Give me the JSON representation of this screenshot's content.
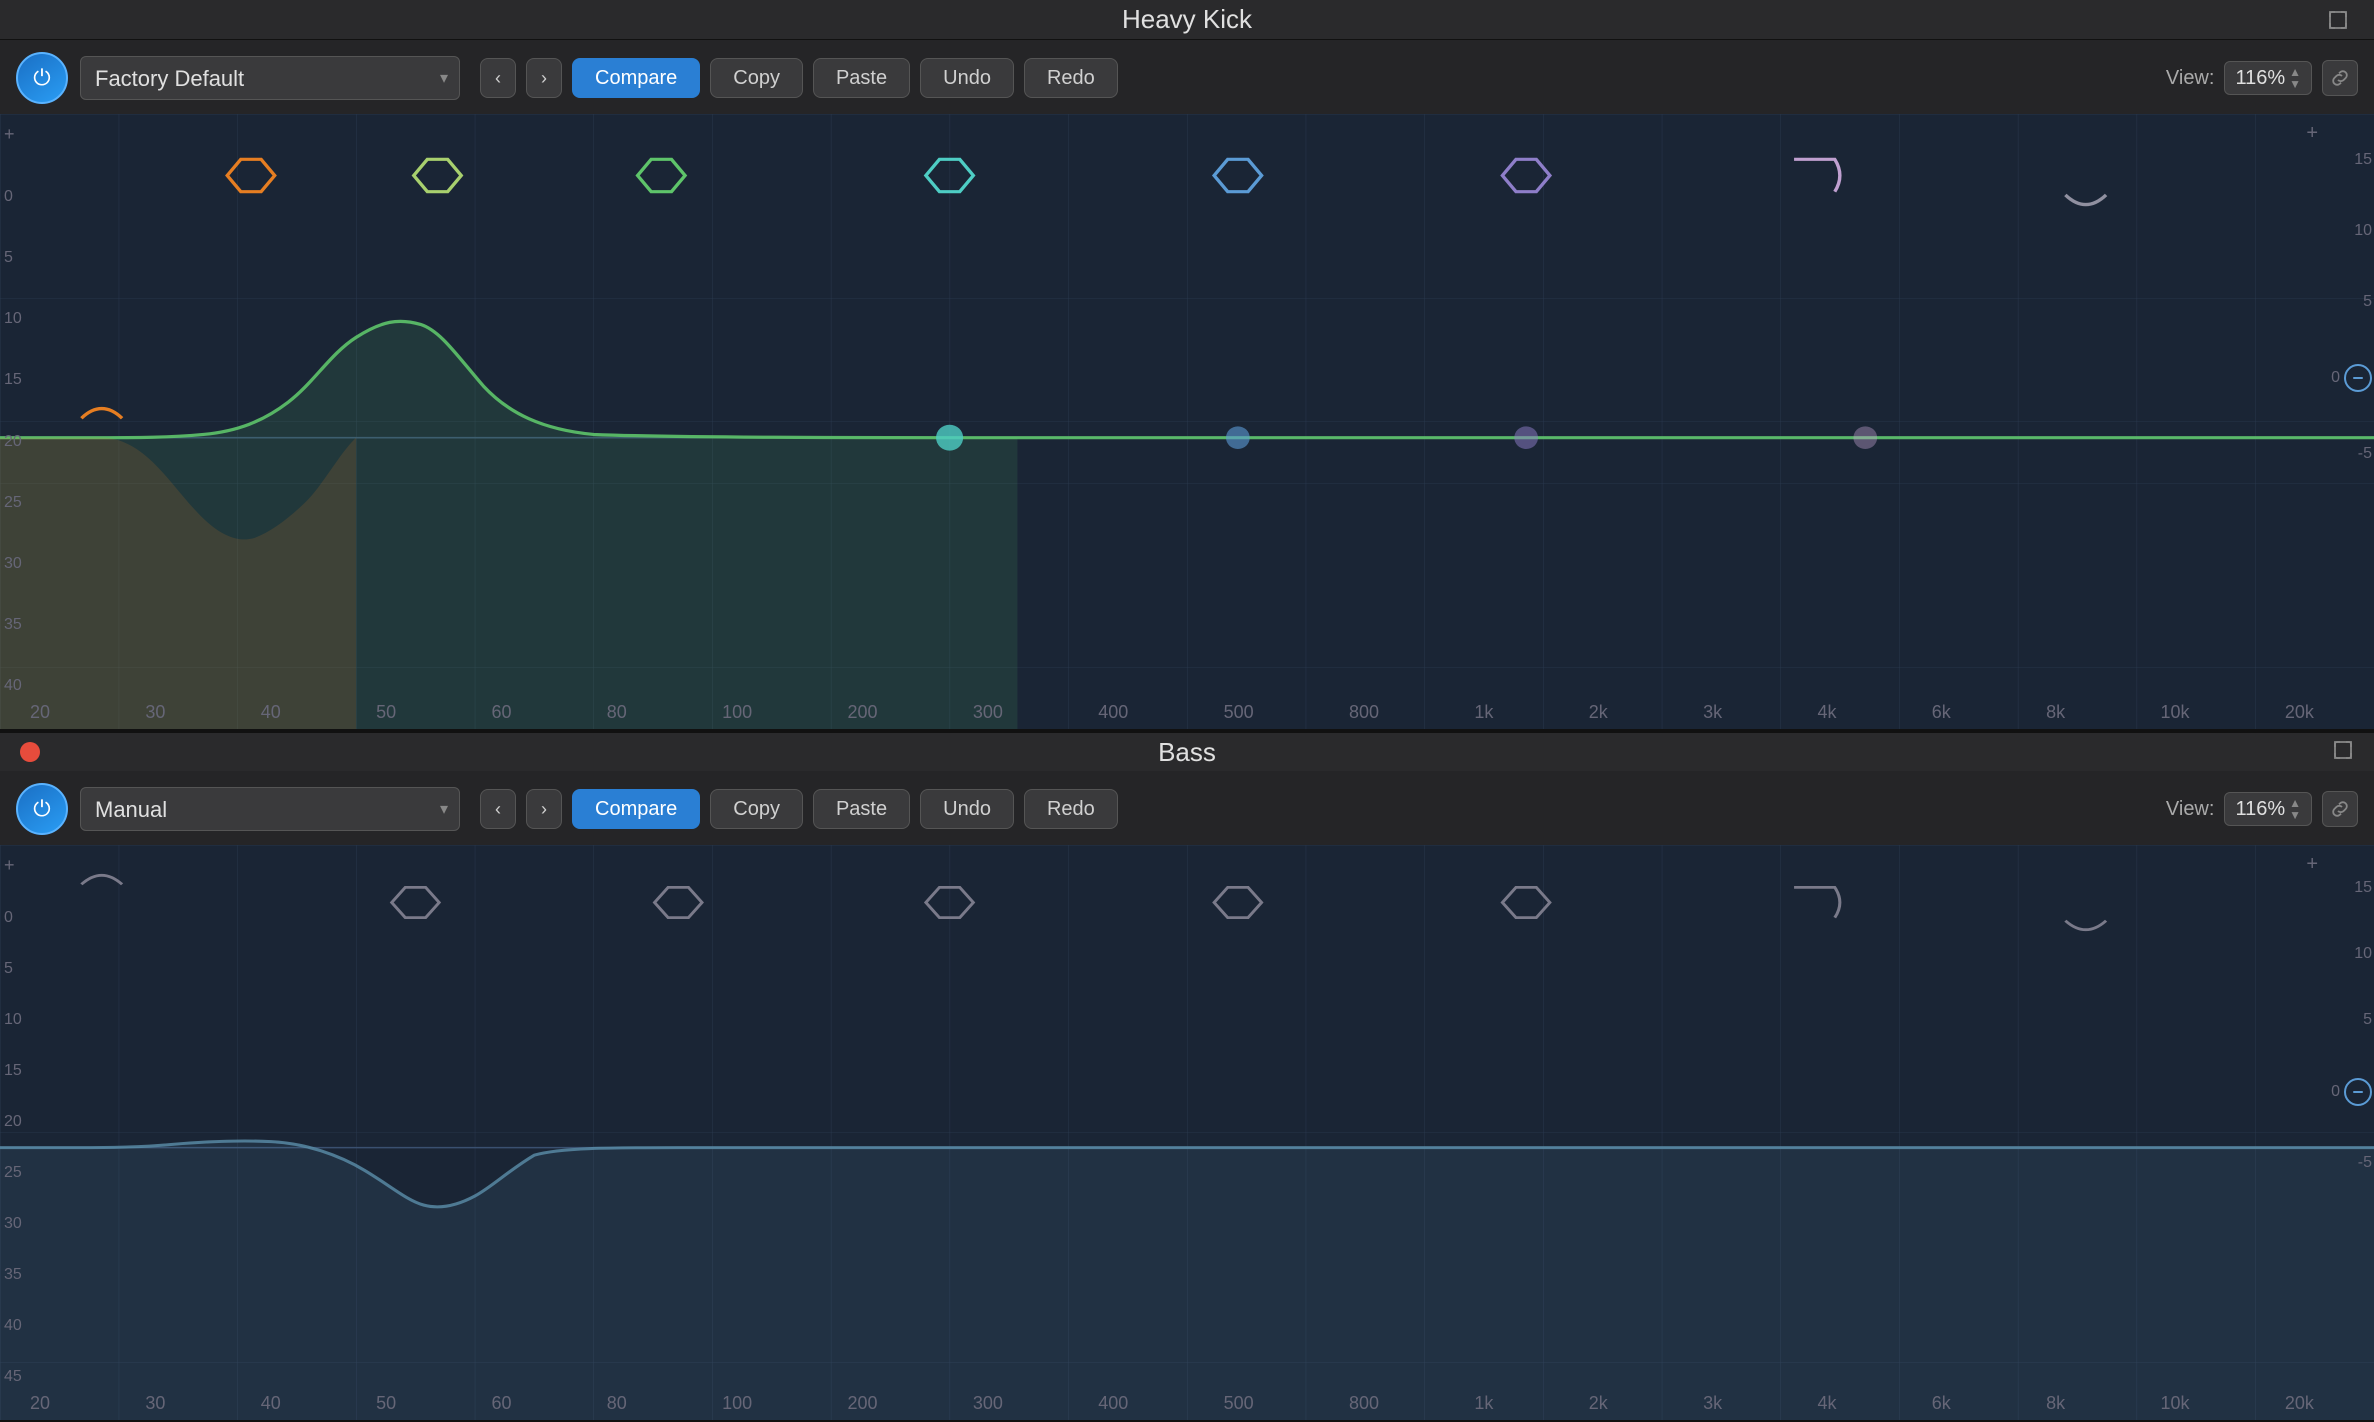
{
  "app": {
    "title": "Heavy Kick"
  },
  "panel1": {
    "title": "Heavy Kick",
    "preset": "Factory Default",
    "power_active": true,
    "toolbar": {
      "prev_label": "‹",
      "next_label": "›",
      "compare_label": "Compare",
      "copy_label": "Copy",
      "paste_label": "Paste",
      "undo_label": "Undo",
      "redo_label": "Redo"
    },
    "view_label": "View:",
    "view_value": "116%",
    "nodes": [
      {
        "id": 1,
        "color": "#e67e22",
        "x_pct": 4.5,
        "type": "highpass"
      },
      {
        "id": 2,
        "color": "#e67e22",
        "x_pct": 11,
        "type": "bell"
      },
      {
        "id": 3,
        "color": "#a8d06e",
        "x_pct": 18,
        "type": "bell"
      },
      {
        "id": 4,
        "color": "#5ec46a",
        "x_pct": 26,
        "type": "bell"
      },
      {
        "id": 5,
        "color": "#4ecdc4",
        "x_pct": 40,
        "type": "bell"
      },
      {
        "id": 6,
        "color": "#5b9bd5",
        "x_pct": 55,
        "type": "bell"
      },
      {
        "id": 7,
        "color": "#8e7ec9",
        "x_pct": 70,
        "type": "bell"
      },
      {
        "id": 8,
        "color": "#c0a0d0",
        "x_pct": 84,
        "type": "highshelf"
      },
      {
        "id": 9,
        "color": "#9090a0",
        "x_pct": 94,
        "type": "highcut"
      }
    ],
    "freq_labels": [
      "20",
      "30",
      "40",
      "50",
      "60",
      "80",
      "100",
      "200",
      "300",
      "400",
      "500",
      "800",
      "1k",
      "2k",
      "3k",
      "4k",
      "6k",
      "8k",
      "10k",
      "20k"
    ],
    "db_labels_left": [
      "+",
      "0",
      "5",
      "10",
      "15",
      "20",
      "25",
      "30",
      "35",
      "40"
    ],
    "db_labels_right": [
      "15",
      "10",
      "5",
      "0",
      "-5"
    ]
  },
  "panel2": {
    "title": "Bass",
    "preset": "Manual",
    "power_active": true,
    "has_red_dot": true,
    "toolbar": {
      "prev_label": "‹",
      "next_label": "›",
      "compare_label": "Compare",
      "copy_label": "Copy",
      "paste_label": "Paste",
      "undo_label": "Undo",
      "redo_label": "Redo"
    },
    "view_label": "View:",
    "view_value": "116%",
    "nodes": [
      {
        "id": 1,
        "color": "#9090a0",
        "x_pct": 4.5,
        "type": "highpass"
      },
      {
        "id": 2,
        "color": "#9090a0",
        "x_pct": 11,
        "type": "bell"
      },
      {
        "id": 3,
        "color": "#9090a0",
        "x_pct": 18,
        "type": "bell"
      },
      {
        "id": 4,
        "color": "#9090a0",
        "x_pct": 26,
        "type": "bell"
      },
      {
        "id": 5,
        "color": "#9090a0",
        "x_pct": 40,
        "type": "bell"
      },
      {
        "id": 6,
        "color": "#9090a0",
        "x_pct": 55,
        "type": "bell"
      },
      {
        "id": 7,
        "color": "#9090a0",
        "x_pct": 70,
        "type": "bell"
      },
      {
        "id": 8,
        "color": "#9090a0",
        "x_pct": 84,
        "type": "highshelf"
      },
      {
        "id": 9,
        "color": "#9090a0",
        "x_pct": 94,
        "type": "highcut"
      }
    ],
    "freq_labels": [
      "20",
      "30",
      "40",
      "50",
      "60",
      "80",
      "100",
      "200",
      "300",
      "400",
      "500",
      "800",
      "1k",
      "2k",
      "3k",
      "4k",
      "6k",
      "8k",
      "10k",
      "20k"
    ],
    "db_labels_left": [
      "+",
      "0",
      "5",
      "10",
      "15",
      "20",
      "25",
      "30",
      "35",
      "40",
      "45"
    ],
    "db_labels_right": [
      "15",
      "10",
      "5",
      "0",
      "-5"
    ]
  }
}
